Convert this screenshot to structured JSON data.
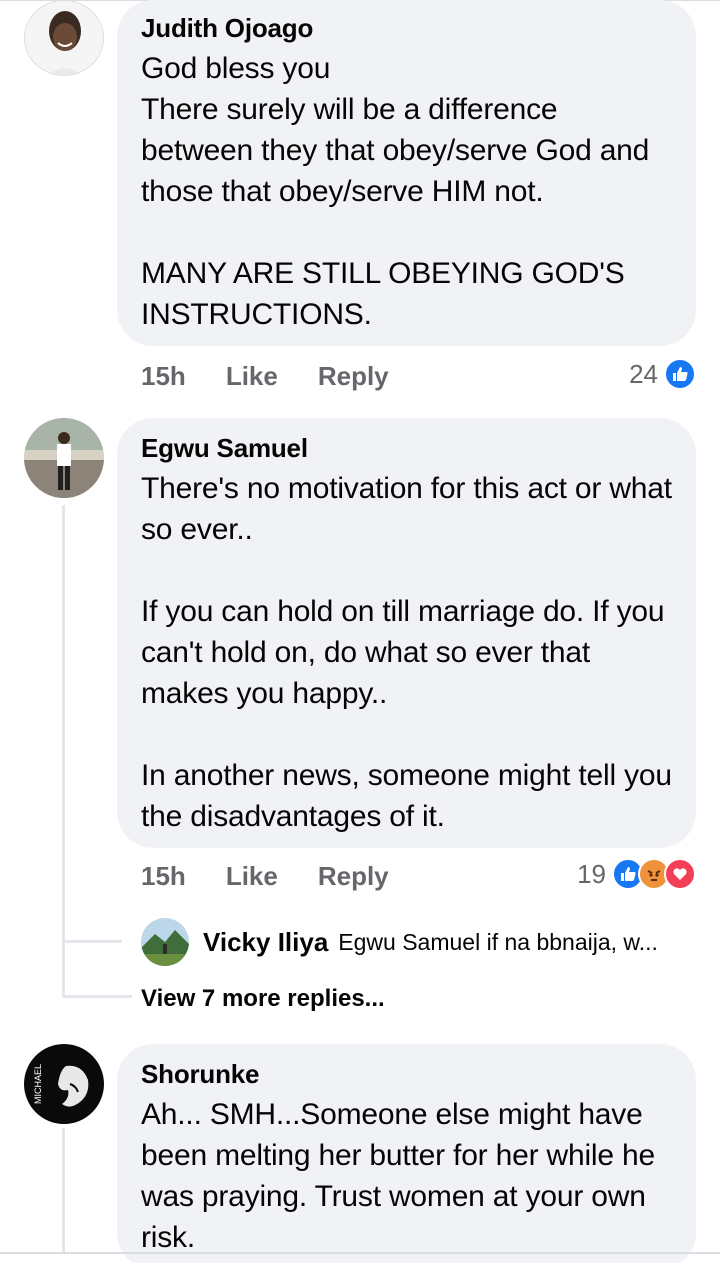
{
  "comments": [
    {
      "author": "Judith Ojoago",
      "text": "God bless you\nThere surely will be a difference between they that obey/serve God and those that obey/serve HIM not.\n\nMANY ARE STILL OBEYING GOD'S INSTRUCTIONS.",
      "time": "15h",
      "like_label": "Like",
      "reply_label": "Reply",
      "reaction_count": "24",
      "reactions": [
        "like-icon"
      ]
    },
    {
      "author": "Egwu Samuel",
      "text": "There's no motivation for this act or what so ever..\n\nIf you can hold on till marriage do. If you can't hold on, do what so ever that makes you happy..\n\nIn another news, someone might tell you the disadvantages of it.",
      "time": "15h",
      "like_label": "Like",
      "reply_label": "Reply",
      "reaction_count": "19",
      "reactions": [
        "like-icon",
        "angry-icon",
        "love-icon"
      ],
      "reply_preview": {
        "author": "Vicky Iliya",
        "text": "Egwu Samuel if na bbnaija, w..."
      },
      "view_more_label": "View 7 more replies..."
    },
    {
      "author": "Shorunke",
      "text": "Ah... SMH...Someone else might have been melting her butter for her while he was praying. Trust women at your own risk.",
      "avatar_text": "MICHAEL"
    }
  ],
  "colors": {
    "bubble": "#f0f2f5",
    "meta": "#65676b",
    "like_blue": "#1877f2",
    "angry_orange": "#f0923a",
    "love_red": "#f33e58"
  }
}
